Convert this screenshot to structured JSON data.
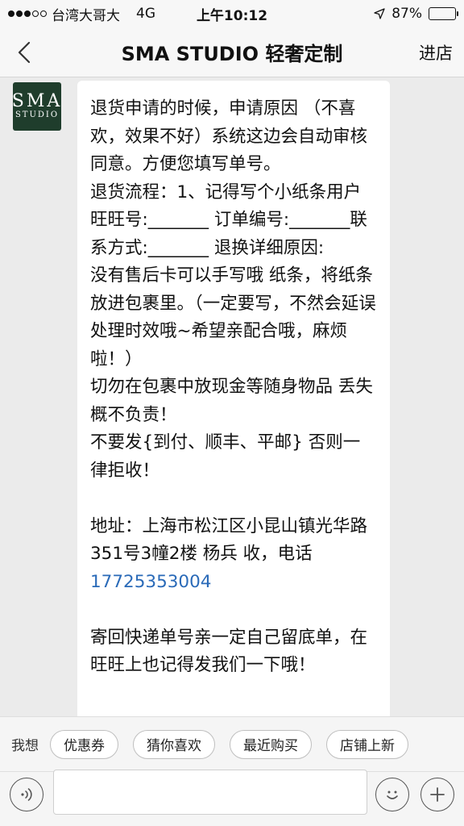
{
  "status_bar": {
    "carrier": "台湾大哥大",
    "network": "4G",
    "time": "上午10:12",
    "battery": "87%"
  },
  "nav": {
    "title": "SMA STUDIO 轻奢定制",
    "shop_label": "进店"
  },
  "avatar": {
    "logo_line1": "SMA",
    "logo_line2": "STUDIO"
  },
  "message": {
    "line1": "退货申请的时候，申请原因 （不喜欢，效果不好）系统这边会自动审核同意。方便您填写单号。",
    "line2": "退货流程：1、记得写个小纸条用户旺旺号:_______ 订单编号:_______联系方式:_______ 退换详细原因:",
    "line3": "没有售后卡可以手写哦 纸条，将纸条放进包裹里。（一定要写，不然会延误处理时效哦~希望亲配合哦，麻烦啦！）",
    "line4": "切勿在包裹中放现金等随身物品 丢失概不负责！",
    "line5": "不要发{到付、顺丰、平邮} 否则一律拒收！",
    "address": "地址：上海市松江区小昆山镇光华路351号3幢2楼 杨兵 收，电话 ",
    "phone": "17725353004",
    "closing": "寄回快递单号亲一定自己留底单，在旺旺上也记得发我们一下哦！"
  },
  "quick_replies": {
    "label": "我想",
    "chips": [
      "优惠券",
      "猜你喜欢",
      "最近购买",
      "店铺上新"
    ]
  },
  "input_bar": {
    "placeholder": ""
  },
  "battery_level": 0.87
}
